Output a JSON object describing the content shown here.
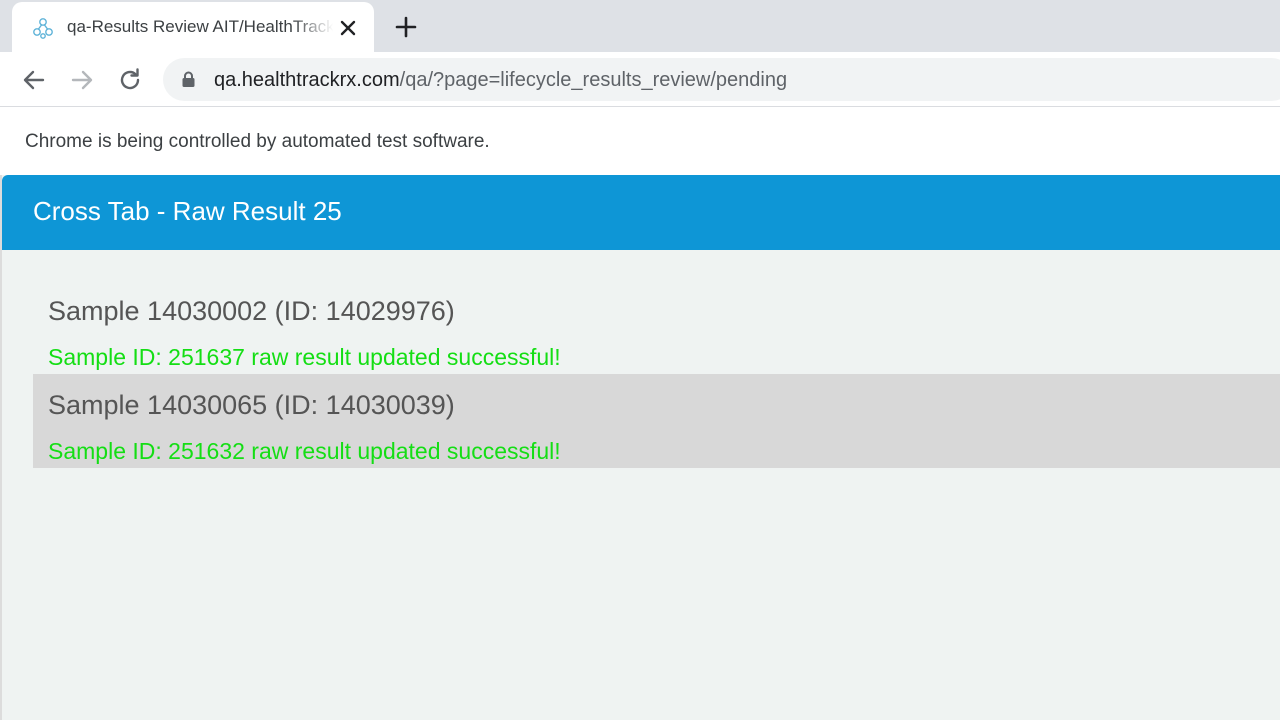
{
  "browser": {
    "tab": {
      "title": "qa-Results Review AIT/HealthTrackRx"
    },
    "address": {
      "host": "qa.healthtrackrx.com",
      "path": "/qa/?page=lifecycle_results_review/pending"
    },
    "infobar": "Chrome is being controlled by automated test software."
  },
  "page": {
    "header_title": "Cross Tab - Raw Result 25",
    "samples": [
      {
        "name": "Sample 14030002 (ID: 14029976)",
        "message": "Sample ID: 251637 raw result updated successful!"
      },
      {
        "name": "Sample 14030065 (ID: 14030039)",
        "message": "Sample ID: 251632 raw result updated successful!"
      }
    ]
  },
  "colors": {
    "header_bg": "#0e96d6",
    "success_text": "#14de14",
    "alt_row_bg": "#d8d8d8"
  },
  "icons": [
    "favicon-icon",
    "close-icon",
    "plus-icon",
    "back-arrow-icon",
    "forward-arrow-icon",
    "reload-icon",
    "lock-icon"
  ]
}
